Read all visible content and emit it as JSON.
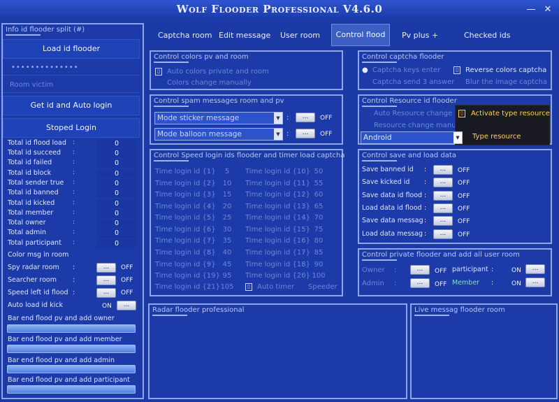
{
  "window": {
    "title": "Wolf Flooder Professional V4.6.0",
    "minimize_glyph": "—",
    "close_glyph": "✕"
  },
  "left": {
    "panel_title": "Info id flooder split (#)",
    "load_button": "Load id flooder",
    "password_value": "••••••••••••••",
    "room_placeholder": "Room victim",
    "get_id_button": "Get id and Auto login",
    "stoped_button": "Stoped Login",
    "stats": [
      {
        "label": "Total id flood load",
        "value": "0"
      },
      {
        "label": "Total id succeed",
        "value": "0"
      },
      {
        "label": "Total id failed",
        "value": "0"
      },
      {
        "label": "Total id block",
        "value": "0"
      },
      {
        "label": "Total sender true",
        "value": "0"
      },
      {
        "label": "Total id banned",
        "value": "0"
      },
      {
        "label": "Total id kicked",
        "value": "0"
      },
      {
        "label": "Total  member",
        "value": "0"
      },
      {
        "label": "Total  owner",
        "value": "0"
      },
      {
        "label": "Total  admin",
        "value": "0"
      },
      {
        "label": "Total  participant",
        "value": "0"
      }
    ],
    "color_msg_label": "Color msg in room",
    "controls": [
      {
        "label": "Spy radar room",
        "state": "OFF"
      },
      {
        "label": "Searcher room",
        "state": "OFF"
      },
      {
        "label": "Speed left id flood",
        "state": "OFF"
      }
    ],
    "auto_load_kick": {
      "label": "Auto load id kick",
      "state": "ON"
    },
    "bars": [
      {
        "label": "Bar end flood  pv and add owner",
        "progress": 0
      },
      {
        "label": "Bar end flood  pv and add member",
        "progress": 0
      },
      {
        "label": "Bar end flood  pv and add admin",
        "progress": 0
      },
      {
        "label": "Bar end flood  pv and add participant",
        "progress": 0
      }
    ]
  },
  "tabs": [
    {
      "label": "Captcha room"
    },
    {
      "label": "Edit message"
    },
    {
      "label": "User room"
    },
    {
      "label": "Control flood"
    },
    {
      "label": "Pv plus +"
    },
    {
      "label": "Checked ids"
    }
  ],
  "colors_panel": {
    "title": "Control colors pv and room",
    "auto_colors": "Auto colors private and room",
    "colors_manual": "Colors change manually"
  },
  "spam_panel": {
    "title": "Control spam messages room and pv",
    "rows": [
      {
        "select": "Mode sticker message",
        "state": "OFF"
      },
      {
        "select": "Mode balloon message",
        "state": "OFF"
      }
    ]
  },
  "speed_panel": {
    "title": "Control Speed login ids flooder and timer load captcha",
    "left": [
      {
        "label": "Time login id {1}",
        "value": "5"
      },
      {
        "label": "Time login id {2}",
        "value": "10"
      },
      {
        "label": "Time login id {3}",
        "value": "15"
      },
      {
        "label": "Time login id {4}",
        "value": "20"
      },
      {
        "label": "Time login id {5}",
        "value": "25"
      },
      {
        "label": "Time login id {6}",
        "value": "30"
      },
      {
        "label": "Time login id {7}",
        "value": "35"
      },
      {
        "label": "Time login id {8}",
        "value": "40"
      },
      {
        "label": "Time login id {9}",
        "value": "45"
      },
      {
        "label": "Time login id {19}",
        "value": "95"
      },
      {
        "label": "Time login id {21}",
        "value": "105"
      }
    ],
    "right": [
      {
        "label": "Time login id {10}",
        "value": "50"
      },
      {
        "label": "Time login id {11}",
        "value": "55"
      },
      {
        "label": "Time login id {12}",
        "value": "60"
      },
      {
        "label": "Time login id {13}",
        "value": "65"
      },
      {
        "label": "Time login id {14}",
        "value": "70"
      },
      {
        "label": "Time login id {15}",
        "value": "75"
      },
      {
        "label": "Time login id {16}",
        "value": "80"
      },
      {
        "label": "Time login id {17}",
        "value": "85"
      },
      {
        "label": "Time login id {18}",
        "value": "90"
      },
      {
        "label": "Time login id {20}",
        "value": "100"
      }
    ],
    "auto_timer": "Auto timer",
    "speeder": "Speeder"
  },
  "captcha_panel": {
    "title": "Control captcha flooder",
    "keys_enter": "Captcha keys enter",
    "reverse": "Reverse colors captcha",
    "send3": "Captcha send 3 answer",
    "blur": "Blur the image captcha"
  },
  "resource_panel": {
    "title": "Control Resource id flooder",
    "auto": "Auto Resource change",
    "activate": "Activate type resource",
    "manual": "Resource change manually",
    "select": "Android",
    "type_label": "Type resource"
  },
  "save_panel": {
    "title": "Control save and load data",
    "rows": [
      {
        "label": "Save banned id",
        "state": "OFF"
      },
      {
        "label": "Save kicked id",
        "state": "OFF"
      },
      {
        "label": "Save data id flood",
        "state": "OFF"
      },
      {
        "label": "Load data id flood",
        "state": "OFF"
      },
      {
        "label": "Save data messag",
        "state": "OFF"
      },
      {
        "label": "Load data messag",
        "state": "OFF"
      }
    ]
  },
  "private_panel": {
    "title": "Control private flooder and add  all user room",
    "owner": {
      "label": "Owner",
      "state": "OFF"
    },
    "admin": {
      "label": "Admin",
      "state": "OFF"
    },
    "participant": {
      "label": "participant",
      "state": "ON"
    },
    "member": {
      "label": "Member",
      "state": "ON"
    }
  },
  "radar_panel": {
    "title": "Radar flooder professional"
  },
  "live_panel": {
    "title": "Live messag flooder room"
  },
  "button_glyph": "...",
  "colon": ":",
  "colors": {
    "background": "#1c3aa6",
    "accent_yellow": "#ffd24a",
    "member_green": "#7fe0c0"
  }
}
